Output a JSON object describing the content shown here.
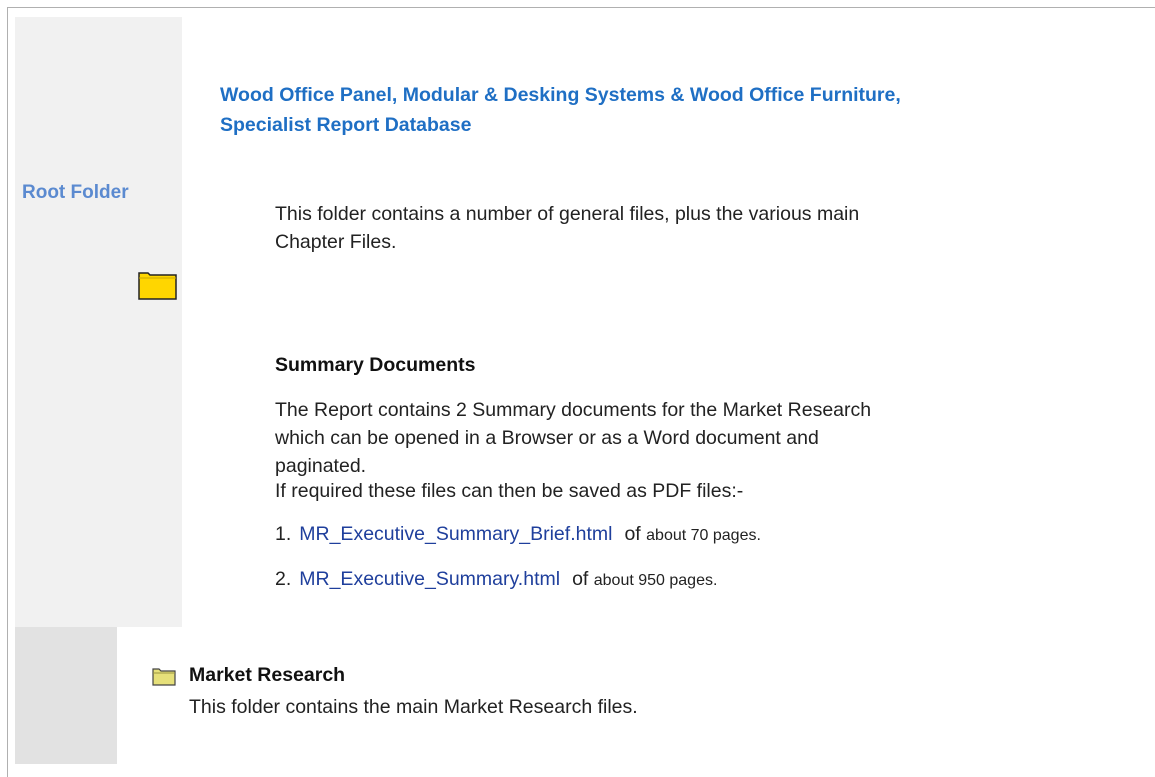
{
  "header": {
    "title_line1": "Wood Office Panel, Modular & Desking Systems & Wood Office Furniture,",
    "title_line2": "Specialist Report Database"
  },
  "sidebar": {
    "root_label": "Root Folder",
    "root_icon": "folder-icon"
  },
  "intro": {
    "text": "This folder contains a number of general files, plus the various main Chapter Files."
  },
  "summary": {
    "title": "Summary Documents",
    "description": "The Report contains 2 Summary documents for the Market Research which can be opened in a Browser or as a Word document and paginated.",
    "pdf_note": "If required these files can then be saved as PDF files:-",
    "items": [
      {
        "num": "1.",
        "file": "MR_Executive_Summary_Brief.html",
        "of": "of",
        "detail": "about 70 pages."
      },
      {
        "num": "2.",
        "file": "MR_Executive_Summary.html",
        "of": "of",
        "detail": "about 950 pages."
      }
    ]
  },
  "market_research": {
    "icon": "folder-icon",
    "title": "Market Research",
    "description": "This folder contains the main Market Research files."
  },
  "colors": {
    "heading": "#1f6fc4",
    "root_label": "#5b8ad0",
    "link": "#1f3f9c",
    "panel_light": "#f1f1f1",
    "panel_dark": "#e2e2e2",
    "folder_fill": "#ffd600"
  }
}
